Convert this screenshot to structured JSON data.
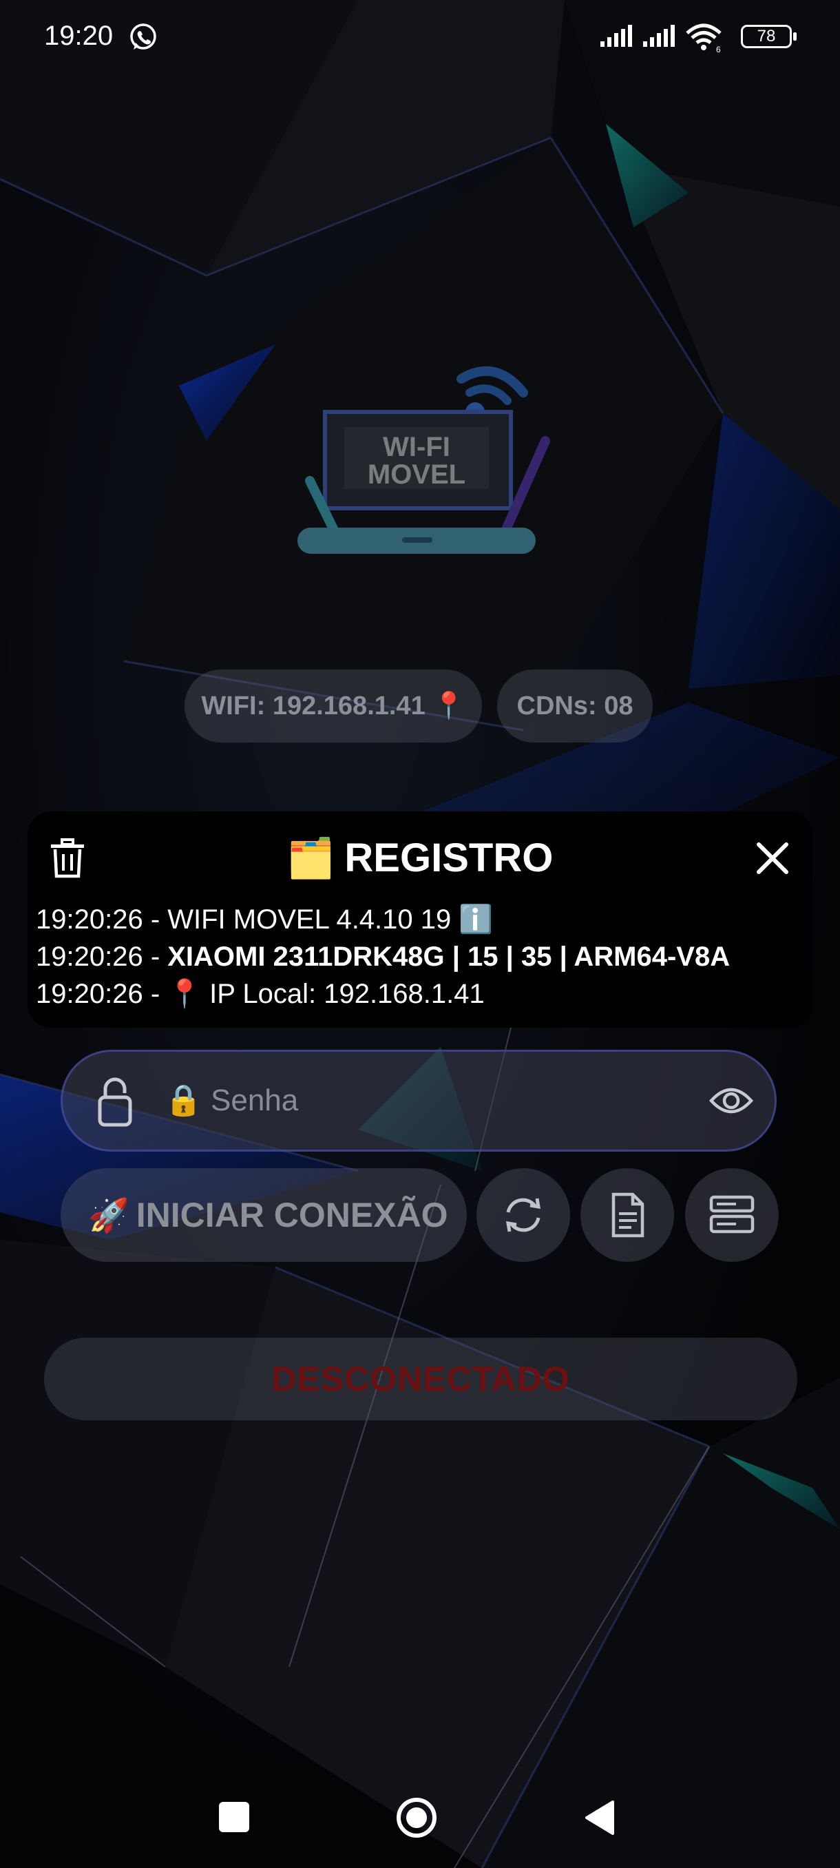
{
  "status_bar": {
    "time": "19:20",
    "battery": "78",
    "icons": [
      "whatsapp-icon",
      "signal-icon",
      "signal-icon",
      "wifi-icon",
      "battery-icon"
    ]
  },
  "logo": {
    "line1": "WI-FI",
    "line2": "MOVEL"
  },
  "chips": {
    "wifi": "WIFI: 192.168.1.41 📍",
    "cdns": "CDNs: 08"
  },
  "dialog": {
    "folder_emoji": "🗂️",
    "title": "REGISTRO",
    "log": [
      {
        "time": "19:20:26 - ",
        "text": "WIFI MOVEL 4.4.10 19 ℹ️"
      },
      {
        "time": "19:20:26 - ",
        "text": "XIAOMI 2311DRK48G | 15 | 35 | ARM64-V8A"
      },
      {
        "time": "19:20:26 - ",
        "text": "📍 IP Local: 192.168.1.41"
      }
    ]
  },
  "password": {
    "placeholder": "🔒 Senha"
  },
  "actions": {
    "start_emoji": "🚀",
    "start_label": "INICIAR CONEXÃO"
  },
  "status": {
    "label": "DESCONECTADO"
  },
  "colors": {
    "accent_blue": "#1e5bff",
    "disconnected": "#6a1010"
  }
}
